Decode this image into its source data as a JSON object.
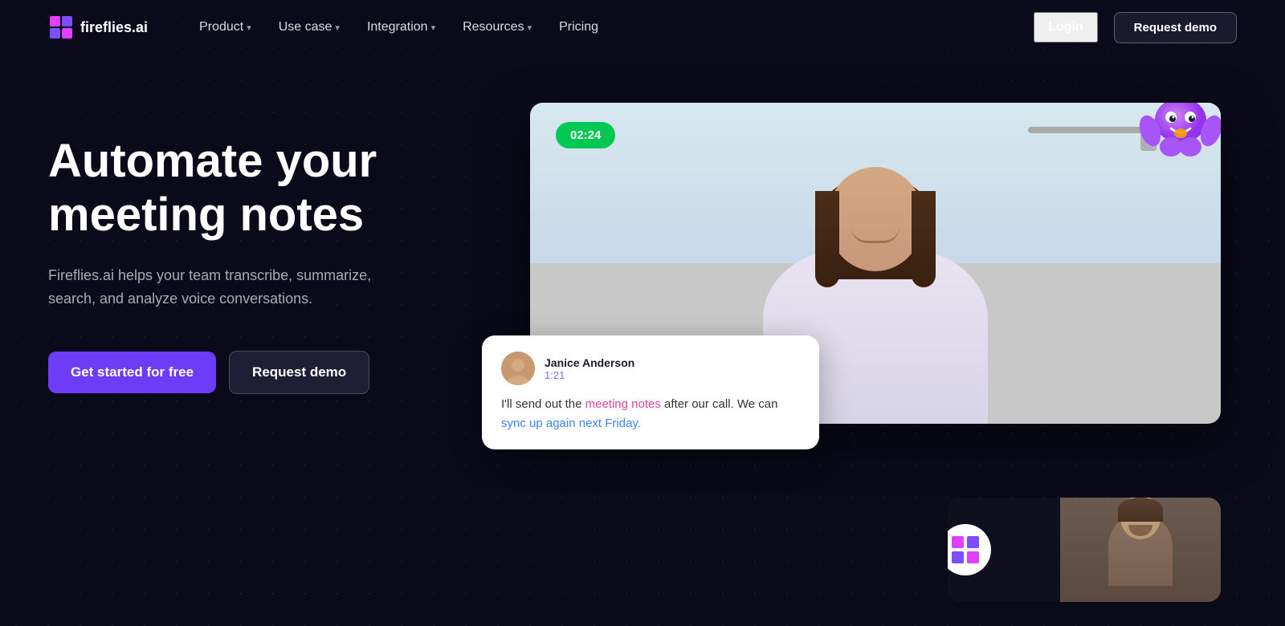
{
  "brand": {
    "name": "fireflies.ai",
    "logo_alt": "fireflies.ai logo"
  },
  "nav": {
    "links": [
      {
        "label": "Product",
        "has_dropdown": true
      },
      {
        "label": "Use case",
        "has_dropdown": true
      },
      {
        "label": "Integration",
        "has_dropdown": true
      },
      {
        "label": "Resources",
        "has_dropdown": true
      },
      {
        "label": "Pricing",
        "has_dropdown": false
      }
    ],
    "login_label": "Login",
    "request_demo_label": "Request demo"
  },
  "hero": {
    "title": "Automate your meeting notes",
    "subtitle": "Fireflies.ai helps your team transcribe, summarize, search, and analyze voice conversations.",
    "cta_primary": "Get started for free",
    "cta_secondary": "Request demo"
  },
  "video_card": {
    "timer": "02:24"
  },
  "chat_card": {
    "user_name": "Janice Anderson",
    "timestamp": "1:21",
    "message_plain": "I'll send out the ",
    "highlight1": "meeting notes",
    "message_mid": " after our call. We can ",
    "highlight2": "sync up again next Friday.",
    "message_end": ""
  },
  "colors": {
    "bg": "#0a0a1a",
    "nav_bg": "#0a0a1a",
    "accent_purple": "#6c3cf7",
    "accent_green": "#00c853",
    "highlight_pink": "#e040a0",
    "highlight_blue": "#3b82f6",
    "chat_time_color": "#7c6cf7"
  }
}
